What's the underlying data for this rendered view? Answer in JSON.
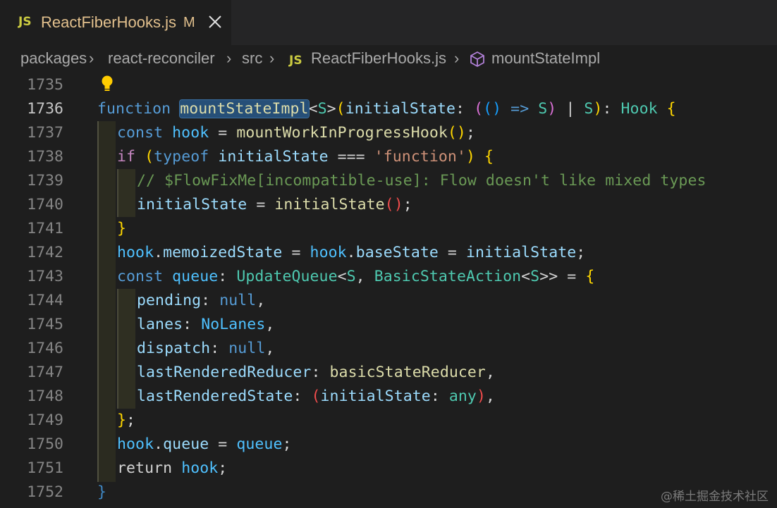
{
  "tab": {
    "icon_text": "JS",
    "title": "ReactFiberHooks.js",
    "modified": "M"
  },
  "breadcrumb": {
    "items": [
      "packages",
      "react-reconciler",
      "src",
      "ReactFiberHooks.js",
      "mountStateImpl"
    ],
    "file_icon_text": "JS",
    "symbol_icon": "symbol-method-cube-icon"
  },
  "editor": {
    "line_numbers": [
      "1735",
      "1736",
      "1737",
      "1738",
      "1739",
      "1740",
      "1741",
      "1742",
      "1743",
      "1744",
      "1745",
      "1746",
      "1747",
      "1748",
      "1749",
      "1750",
      "1751",
      "1752"
    ],
    "active_line": "1736",
    "tokens": {
      "l1736": [
        "function",
        " ",
        "mountStateImpl",
        "<",
        "S",
        ">",
        "(",
        "initialState",
        ": ",
        "(",
        "()",
        " => ",
        "S",
        ")",
        " | ",
        "S",
        ")",
        ": ",
        "Hook",
        " ",
        "{"
      ],
      "l1737": [
        "const",
        " ",
        "hook",
        " = ",
        "mountWorkInProgressHook",
        "()",
        ";"
      ],
      "l1738": [
        "if",
        " ",
        "(",
        "typeof",
        " ",
        "initialState",
        " === ",
        "'function'",
        ")",
        " ",
        "{"
      ],
      "l1739": [
        "// $FlowFixMe[incompatible-use]: Flow doesn't like mixed types"
      ],
      "l1740": [
        "initialState",
        " = ",
        "initialState",
        "()",
        ";"
      ],
      "l1741": [
        "}"
      ],
      "l1742": [
        "hook",
        ".",
        "memoizedState",
        " = ",
        "hook",
        ".",
        "baseState",
        " = ",
        "initialState",
        ";"
      ],
      "l1743": [
        "const",
        " ",
        "queue",
        ": ",
        "UpdateQueue",
        "<",
        "S",
        ", ",
        "BasicStateAction",
        "<",
        "S",
        ">>",
        " = ",
        "{"
      ],
      "l1744": [
        "pending",
        ": ",
        "null",
        ","
      ],
      "l1745": [
        "lanes",
        ": ",
        "NoLanes",
        ","
      ],
      "l1746": [
        "dispatch",
        ": ",
        "null",
        ","
      ],
      "l1747": [
        "lastRenderedReducer",
        ": ",
        "basicStateReducer",
        ","
      ],
      "l1748": [
        "lastRenderedState",
        ": ",
        "(",
        "initialState",
        ": ",
        "any",
        ")",
        ","
      ],
      "l1749": [
        "}",
        ";"
      ],
      "l1750": [
        "hook",
        ".",
        "queue",
        " = ",
        "queue",
        ";"
      ],
      "l1751": [
        "return",
        " ",
        "hook",
        ";"
      ],
      "l1752": [
        "}"
      ]
    }
  },
  "watermark": "@稀土掘金技术社区",
  "colors": {
    "background": "#1e1e1e",
    "tab_text_modified": "#e2c08d",
    "keyword": "#569cd6",
    "control": "#c586c0",
    "function": "#dcdcaa",
    "variable": "#9cdcfe",
    "type": "#4ec9b0",
    "string": "#ce9178",
    "comment": "#6a9955",
    "selection": "#264f78"
  }
}
